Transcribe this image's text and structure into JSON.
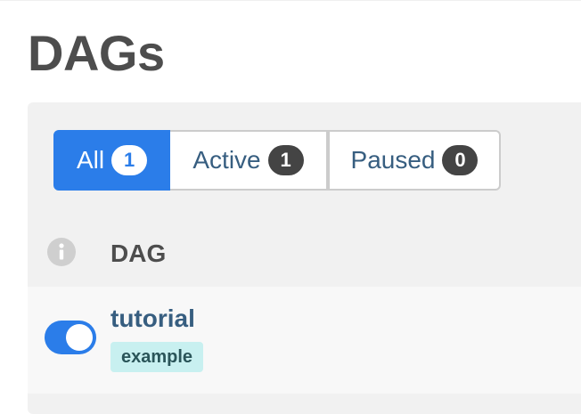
{
  "page": {
    "title": "DAGs"
  },
  "filters": {
    "items": [
      {
        "label": "All",
        "count": "1",
        "selected": true
      },
      {
        "label": "Active",
        "count": "1",
        "selected": false
      },
      {
        "label": "Paused",
        "count": "0",
        "selected": false
      }
    ]
  },
  "table": {
    "info_icon": "info-icon",
    "columns": [
      "DAG"
    ]
  },
  "dags": [
    {
      "name": "tutorial",
      "tags": [
        "example"
      ],
      "enabled": true
    }
  ],
  "colors": {
    "accent": "#2b7de9",
    "link": "#375e80",
    "tag_bg": "#c8f0f0"
  }
}
